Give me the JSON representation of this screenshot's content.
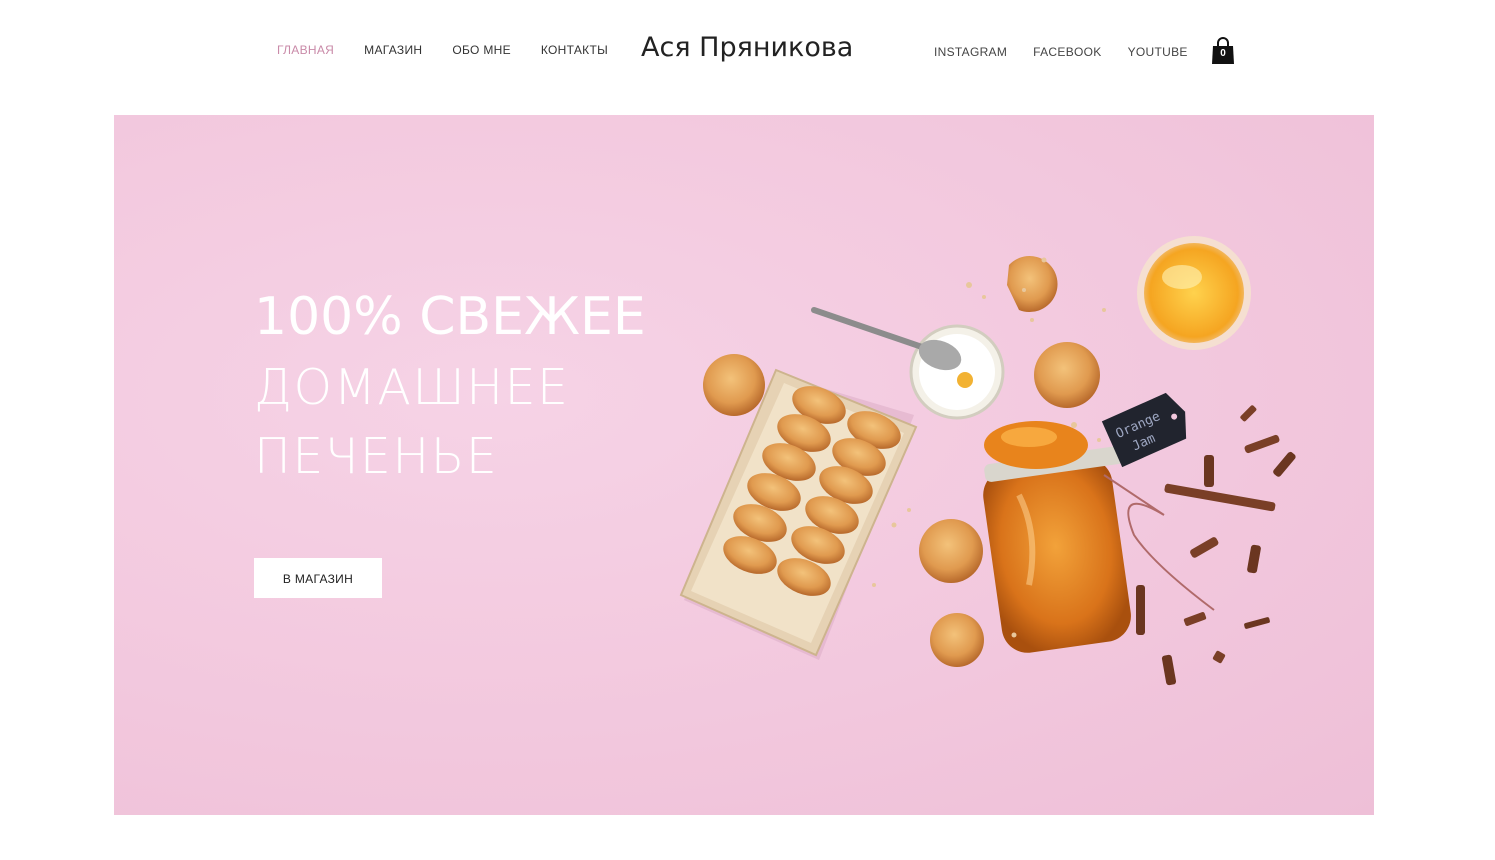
{
  "header": {
    "nav": [
      {
        "label": "ГЛАВНАЯ",
        "active": true
      },
      {
        "label": "МАГАЗИН",
        "active": false
      },
      {
        "label": "ОБО МНЕ",
        "active": false
      },
      {
        "label": "КОНТАКТЫ",
        "active": false
      }
    ],
    "brand": "Ася Пряникова",
    "social": [
      {
        "label": "INSTAGRAM"
      },
      {
        "label": "FACEBOOK"
      },
      {
        "label": "YOUTUBE"
      }
    ],
    "cart": {
      "icon": "shopping-bag-icon",
      "count": "0"
    }
  },
  "hero": {
    "line1": "100% СВЕЖЕЕ",
    "line2": "ДОМАШНЕЕ",
    "line3": "ПЕЧЕНЬЕ",
    "button_label": "В МАГАЗИН",
    "jar_tag": {
      "line1": "Orange",
      "line2": "Jam"
    }
  },
  "colors": {
    "accent_active_nav": "#c98aa8",
    "hero_background": "#f2c7dd",
    "text_dark": "#222222"
  }
}
